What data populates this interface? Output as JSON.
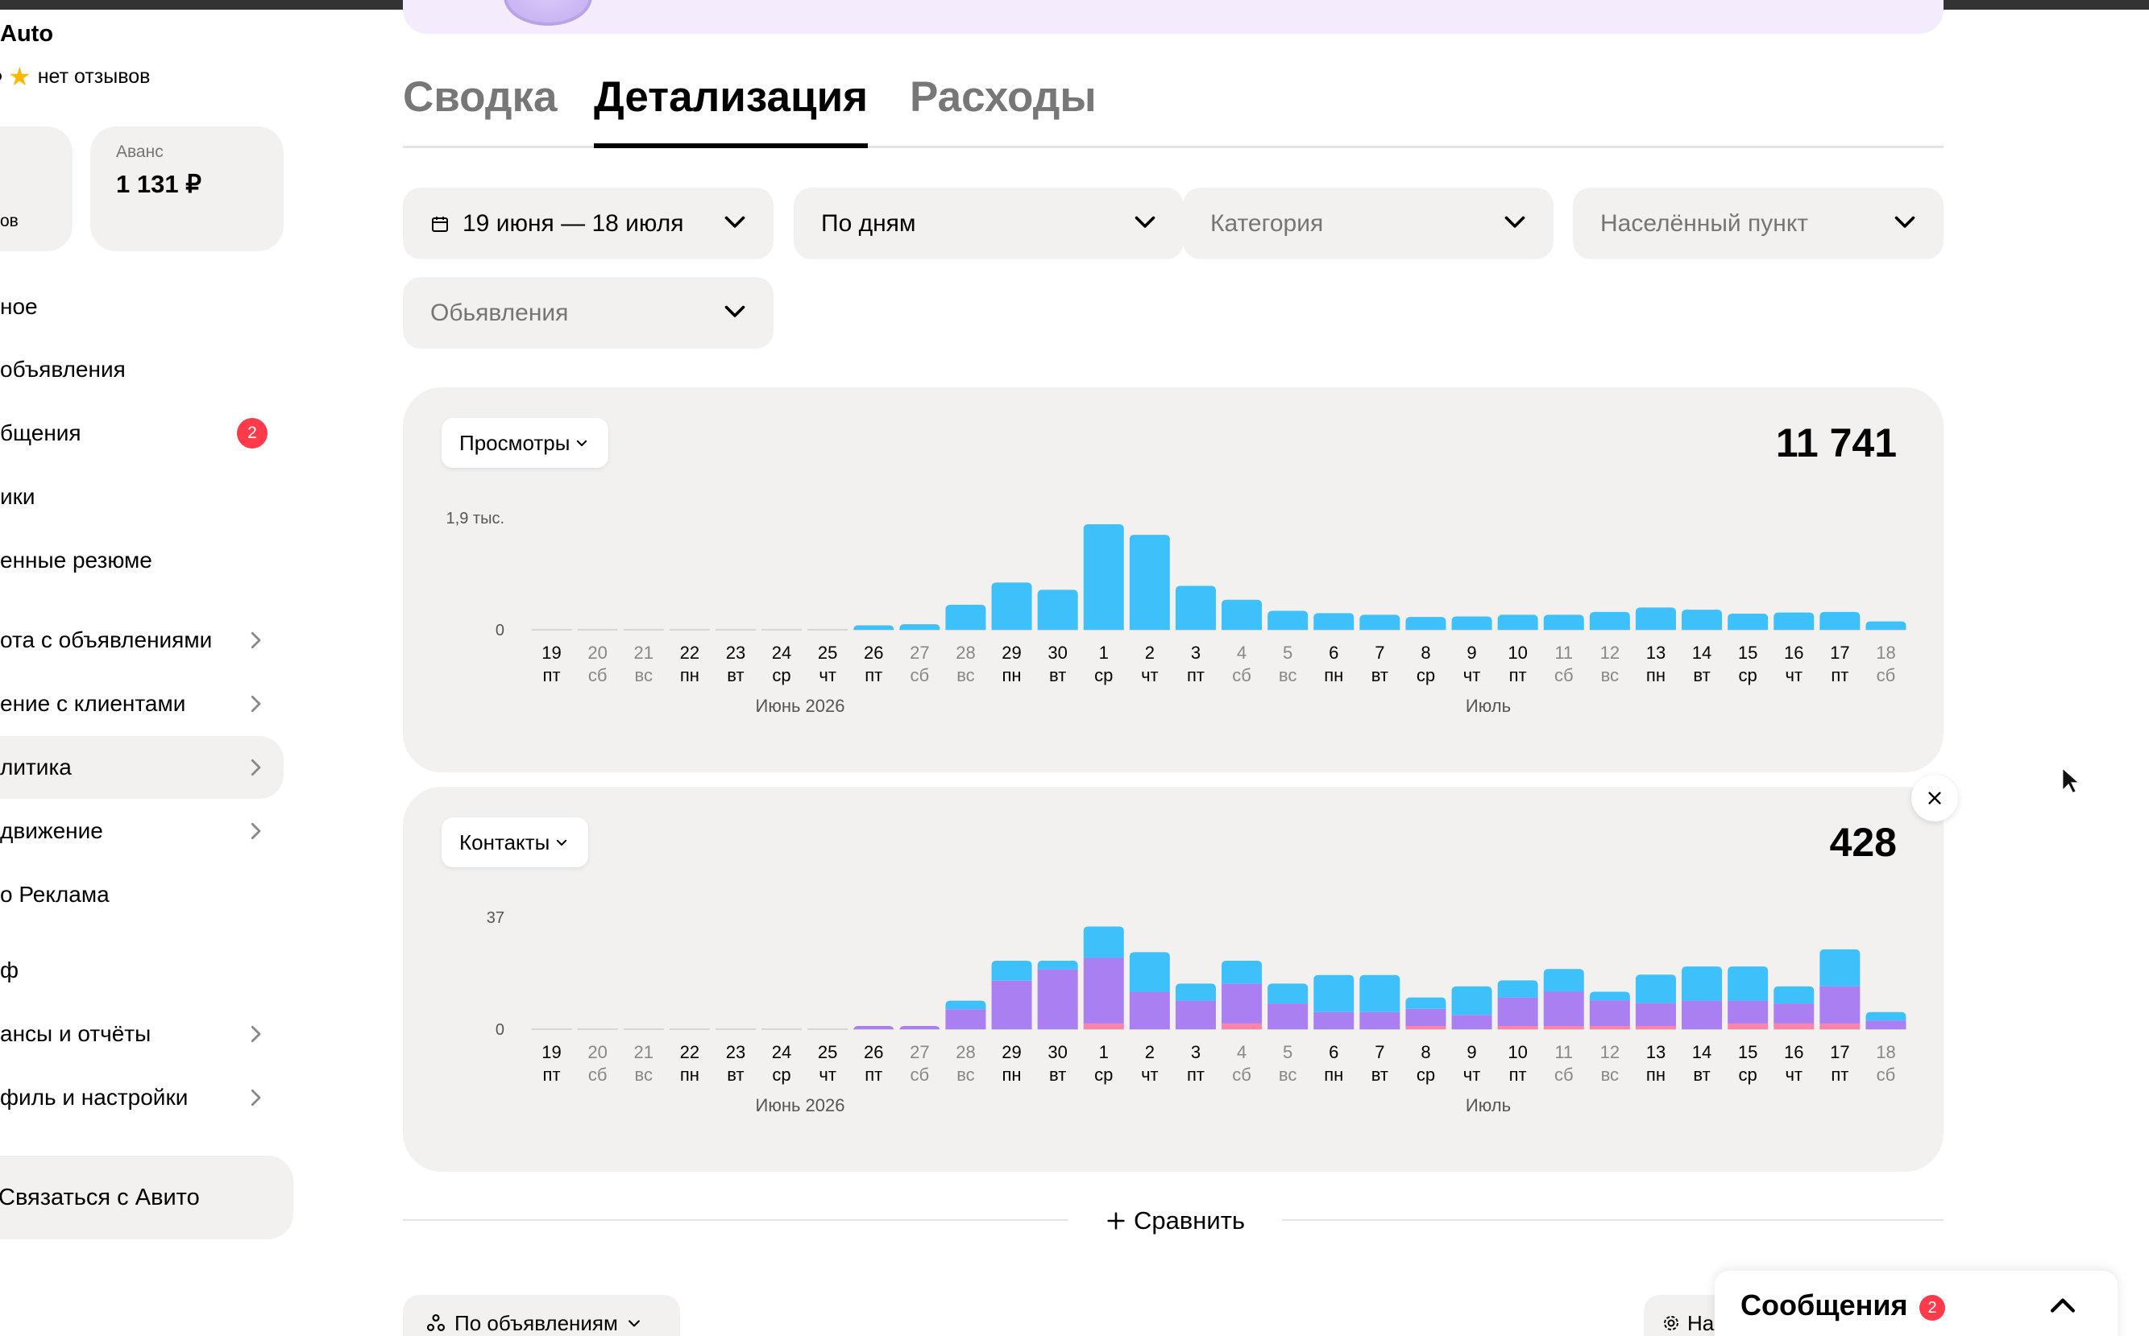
{
  "sidebar": {
    "shop_name": "Auto",
    "rating_text": "нет отзывов",
    "card_left_label": "ов",
    "avans_label": "Аванс",
    "avans_value": "1 131 ₽",
    "items": [
      {
        "label": "ное"
      },
      {
        "label": "объявления"
      },
      {
        "label": "бщения",
        "badge": "2"
      },
      {
        "label": "ики"
      },
      {
        "label": "енные резюме"
      },
      {
        "label": "ота с объявлениями"
      },
      {
        "label": "ение с клиентами"
      },
      {
        "label": "литика"
      },
      {
        "label": "движение"
      },
      {
        "label": "о Реклама"
      },
      {
        "label": "ф"
      },
      {
        "label": "ансы и отчёты"
      },
      {
        "label": "филь и настройки"
      }
    ],
    "contact_button": "Связаться с Авито"
  },
  "tabs": [
    {
      "label": "Сводка"
    },
    {
      "label": "Детализация",
      "active": true
    },
    {
      "label": "Расходы"
    }
  ],
  "filters": {
    "date_range": "19 июня — 18 июля",
    "grouping": "По дням",
    "category_placeholder": "Категория",
    "city_placeholder": "Населённый пункт",
    "ads_placeholder": "Обьявления"
  },
  "colors": {
    "views_bar": "#3ec0fb",
    "contacts_primary": "#a97ff2",
    "contacts_secondary": "#3ec0fb",
    "contacts_tertiary": "#ff82a8",
    "card_bg": "#f2f1f0",
    "badge": "#ff3b4b"
  },
  "chart_data": [
    {
      "type": "bar",
      "metric_label": "Просмотры",
      "total": "11 741",
      "y_max_label": "1,9 тыс.",
      "y_zero_label": "0",
      "ylim": [
        0,
        1900
      ],
      "month_labels": [
        "Июнь 2026",
        "Июль"
      ],
      "x_days": [
        "19",
        "20",
        "21",
        "22",
        "23",
        "24",
        "25",
        "26",
        "27",
        "28",
        "29",
        "30",
        "1",
        "2",
        "3",
        "4",
        "5",
        "6",
        "7",
        "8",
        "9",
        "10",
        "11",
        "12",
        "13",
        "14",
        "15",
        "16",
        "17",
        "18"
      ],
      "x_weekdays": [
        "пт",
        "сб",
        "вс",
        "пн",
        "вт",
        "ср",
        "чт",
        "пт",
        "сб",
        "вс",
        "пн",
        "вт",
        "ср",
        "чт",
        "пт",
        "сб",
        "вс",
        "пн",
        "вт",
        "ср",
        "чт",
        "пт",
        "сб",
        "вс",
        "пн",
        "вт",
        "ср",
        "чт",
        "пт",
        "сб"
      ],
      "series": [
        {
          "values": [
            0,
            0,
            0,
            0,
            0,
            0,
            0,
            80,
            100,
            450,
            850,
            720,
            1900,
            1710,
            790,
            540,
            340,
            300,
            270,
            230,
            240,
            270,
            270,
            320,
            400,
            360,
            290,
            310,
            320,
            150
          ]
        }
      ]
    },
    {
      "type": "bar",
      "metric_label": "Контакты",
      "total": "428",
      "y_max_label": "37",
      "y_zero_label": "0",
      "ylim": [
        0,
        37
      ],
      "month_labels": [
        "Июнь 2026",
        "Июль"
      ],
      "x_days": [
        "19",
        "20",
        "21",
        "22",
        "23",
        "24",
        "25",
        "26",
        "27",
        "28",
        "29",
        "30",
        "1",
        "2",
        "3",
        "4",
        "5",
        "6",
        "7",
        "8",
        "9",
        "10",
        "11",
        "12",
        "13",
        "14",
        "15",
        "16",
        "17",
        "18"
      ],
      "x_weekdays": [
        "пт",
        "сб",
        "вс",
        "пн",
        "вт",
        "ср",
        "чт",
        "пт",
        "сб",
        "вс",
        "пн",
        "вт",
        "ср",
        "чт",
        "пт",
        "сб",
        "вс",
        "пн",
        "вт",
        "ср",
        "чт",
        "пт",
        "сб",
        "вс",
        "пн",
        "вт",
        "ср",
        "чт",
        "пт",
        "сб"
      ],
      "series": [
        {
          "values": [
            0,
            0,
            0,
            0,
            0,
            0,
            0,
            0,
            0,
            0,
            0,
            0,
            2,
            0,
            0,
            2,
            0,
            0,
            0,
            1,
            0,
            1,
            1,
            1,
            1,
            0,
            2,
            2,
            2,
            0
          ]
        },
        {
          "values": [
            0,
            0,
            0,
            0,
            0,
            0,
            0,
            1,
            1,
            7,
            17,
            21,
            23,
            13,
            10,
            14,
            9,
            6,
            6,
            6,
            5,
            10,
            12,
            9,
            8,
            10,
            8,
            7,
            13,
            3
          ]
        },
        {
          "values": [
            0,
            0,
            0,
            0,
            0,
            0,
            0,
            0,
            0,
            3,
            7,
            3,
            11,
            14,
            6,
            8,
            7,
            13,
            13,
            4,
            10,
            6,
            8,
            3,
            10,
            12,
            12,
            6,
            13,
            3
          ]
        }
      ]
    }
  ],
  "close_icon": "close-icon",
  "compare_label": "Сравнить",
  "by_ads_label": "По объявлениям",
  "settings_label": "На",
  "messages": {
    "title": "Сообщения",
    "badge": "2"
  }
}
